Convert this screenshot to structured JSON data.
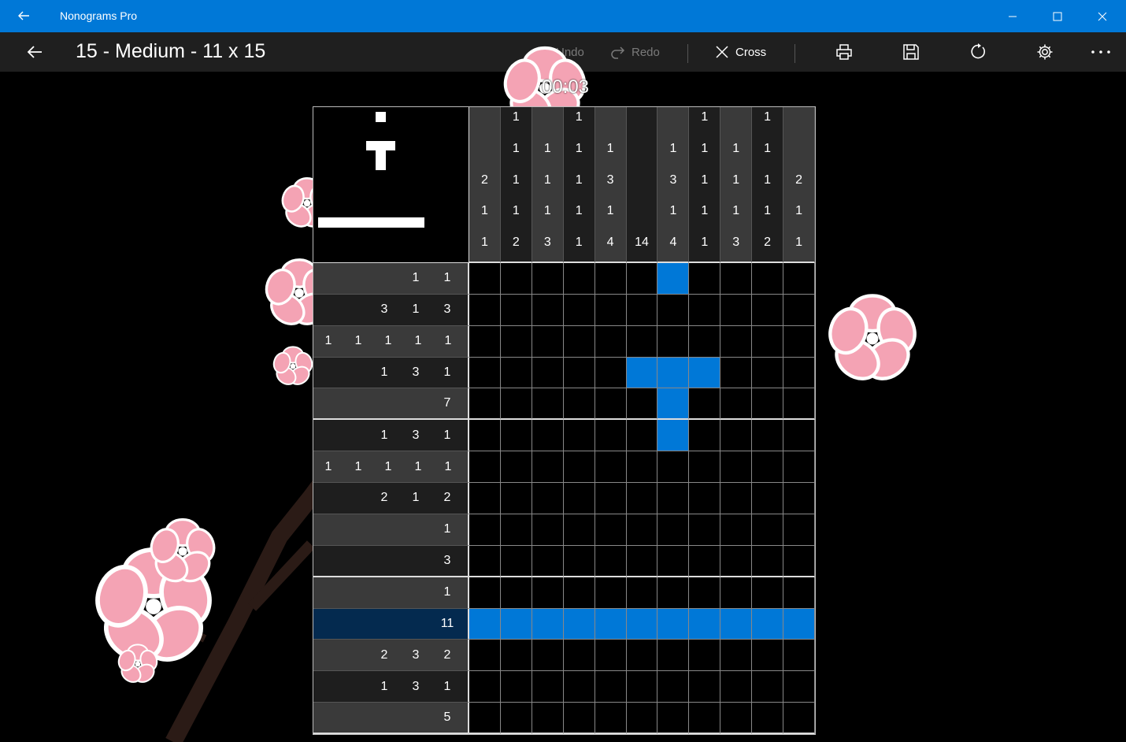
{
  "titlebar": {
    "app_title": "Nonograms Pro"
  },
  "commandbar": {
    "title": "15 - Medium - 11 x 15",
    "undo_label": "Undo",
    "redo_label": "Redo",
    "cross_label": "Cross"
  },
  "timer": "00:03",
  "puzzle": {
    "cols": 11,
    "rows": 15,
    "col_clues": [
      [
        "2",
        "1",
        "1"
      ],
      [
        "1",
        "1",
        "1",
        "1",
        "2"
      ],
      [
        "1",
        "1",
        "1",
        "3"
      ],
      [
        "1",
        "1",
        "1",
        "1",
        "1"
      ],
      [
        "1",
        "3",
        "1",
        "4"
      ],
      [
        "14"
      ],
      [
        "1",
        "3",
        "1",
        "4"
      ],
      [
        "1",
        "1",
        "1",
        "1",
        "1"
      ],
      [
        "1",
        "1",
        "1",
        "3"
      ],
      [
        "1",
        "1",
        "1",
        "1",
        "2"
      ],
      [
        "2",
        "1",
        "1"
      ]
    ],
    "row_clues": [
      [
        "1",
        "1"
      ],
      [
        "3",
        "1",
        "3"
      ],
      [
        "1",
        "1",
        "1",
        "1",
        "1"
      ],
      [
        "1",
        "3",
        "1"
      ],
      [
        "7"
      ],
      [
        "1",
        "3",
        "1"
      ],
      [
        "1",
        "1",
        "1",
        "1",
        "1"
      ],
      [
        "2",
        "1",
        "2"
      ],
      [
        "1"
      ],
      [
        "3"
      ],
      [
        "1"
      ],
      [
        "11"
      ],
      [
        "2",
        "3",
        "2"
      ],
      [
        "1",
        "3",
        "1"
      ],
      [
        "5"
      ]
    ],
    "filled": [
      [
        0,
        6
      ],
      [
        3,
        5
      ],
      [
        3,
        6
      ],
      [
        3,
        7
      ],
      [
        4,
        6
      ],
      [
        5,
        6
      ],
      [
        11,
        0
      ],
      [
        11,
        1
      ],
      [
        11,
        2
      ],
      [
        11,
        3
      ],
      [
        11,
        4
      ],
      [
        11,
        5
      ],
      [
        11,
        6
      ],
      [
        11,
        7
      ],
      [
        11,
        8
      ],
      [
        11,
        9
      ],
      [
        11,
        10
      ]
    ],
    "active_row": 11
  },
  "colors": {
    "accent": "#0078d7",
    "blossom": "#f4a3b4",
    "blossom_center": "#ffffff"
  }
}
